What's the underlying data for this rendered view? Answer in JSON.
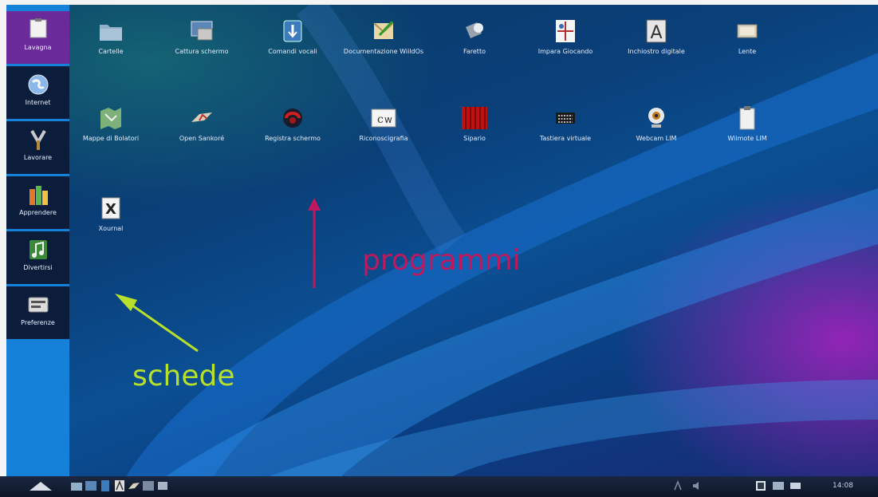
{
  "sidebar": {
    "tabs": [
      {
        "label": "Lavagna"
      },
      {
        "label": "Internet"
      },
      {
        "label": "Lavorare"
      },
      {
        "label": "Apprendere"
      },
      {
        "label": "Divertirsi"
      },
      {
        "label": "Preferenze"
      }
    ]
  },
  "desktop": {
    "icons": [
      {
        "label": "Cartelle"
      },
      {
        "label": "Cattura schermo"
      },
      {
        "label": "Comandi vocali"
      },
      {
        "label": "Documentazione WiildOs"
      },
      {
        "label": "Faretto"
      },
      {
        "label": "Impara Giocando"
      },
      {
        "label": "Inchiostro digitale"
      },
      {
        "label": "Lente"
      },
      {
        "label": "Mappe di Bolatori"
      },
      {
        "label": "Open Sankoré"
      },
      {
        "label": "Registra schermo"
      },
      {
        "label": "Riconoscigrafia"
      },
      {
        "label": "Sipario"
      },
      {
        "label": "Tastiera virtuale"
      },
      {
        "label": "Webcam LIM"
      },
      {
        "label": "Wiimote LIM"
      },
      {
        "label": "Xournal"
      }
    ]
  },
  "annotations": {
    "programs_label": "programmi",
    "tabs_label": "schede",
    "programs_color": "#c0185c",
    "tabs_color": "#b8e02a"
  },
  "taskbar": {
    "clock": "14:08"
  }
}
